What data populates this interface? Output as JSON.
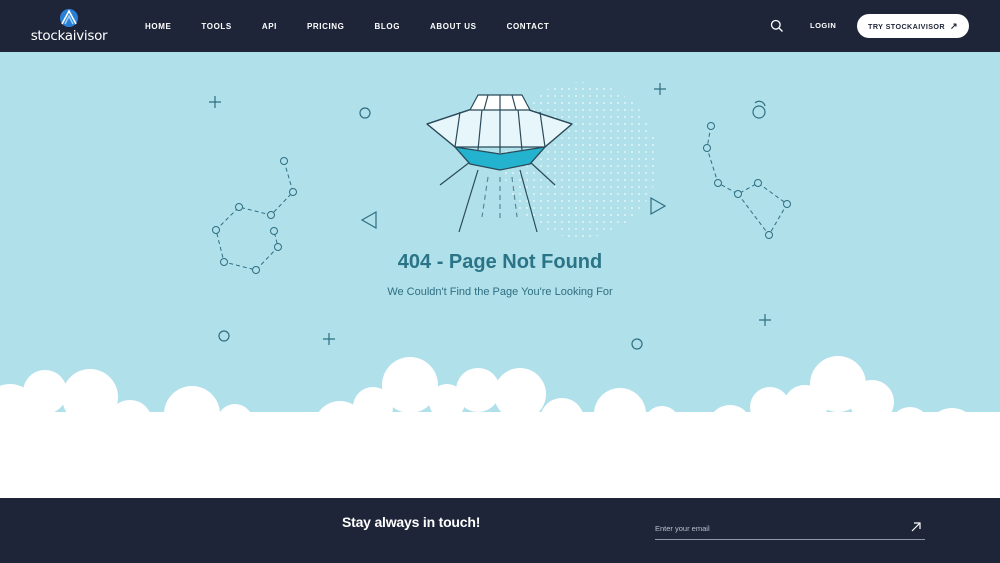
{
  "brand": {
    "name": "stockaivisor"
  },
  "nav": {
    "items": [
      "HOME",
      "TOOLS",
      "API",
      "PRICING",
      "BLOG",
      "ABOUT US",
      "CONTACT"
    ],
    "login": "LOGIN",
    "cta": "TRY STOCKAIVISOR"
  },
  "error": {
    "title": "404 - Page Not Found",
    "subtitle": "We Couldn't Find the Page You're Looking For"
  },
  "footer": {
    "heading": "Stay always in touch!",
    "email_placeholder": "Enter your email"
  },
  "colors": {
    "navbar": "#1e2538",
    "hero": "#b0e0ea",
    "title": "#2b7487",
    "accent": "#23b3cf"
  },
  "icons": [
    "logo-icon",
    "search-icon",
    "arrow-up-right-icon",
    "ufo-illustration"
  ]
}
